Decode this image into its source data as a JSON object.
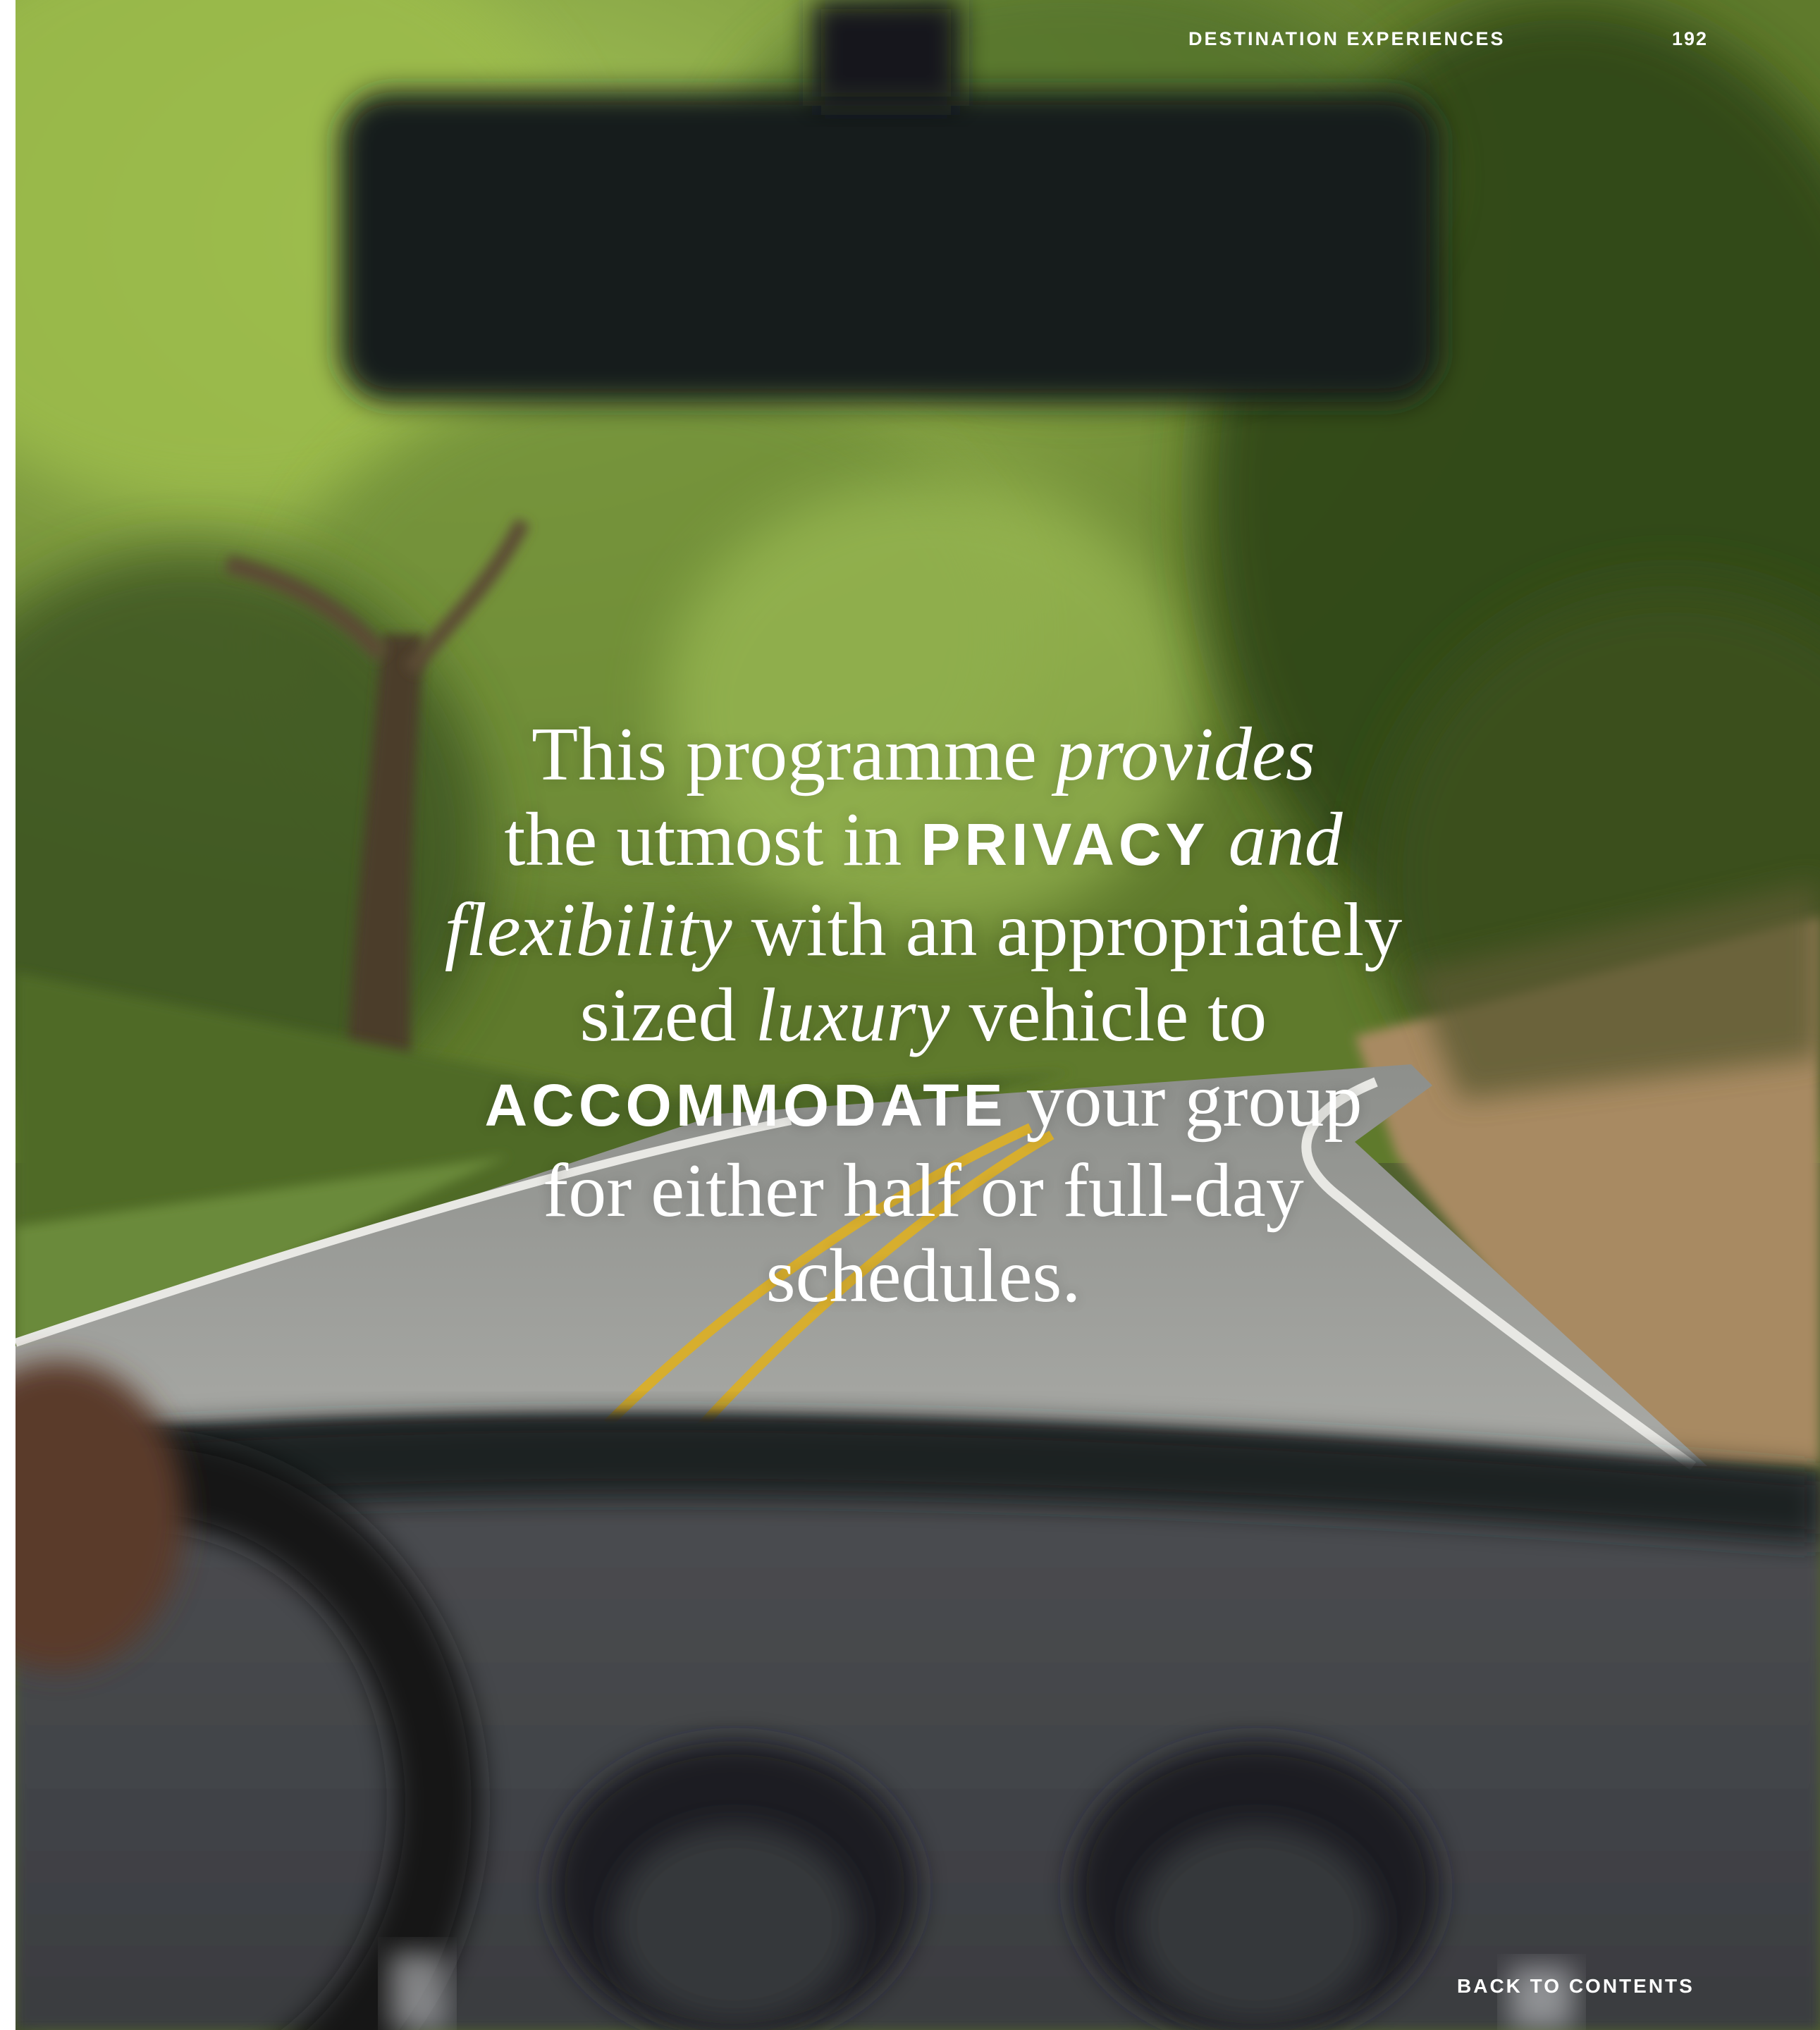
{
  "header": {
    "section": "DESTINATION EXPERIENCES",
    "page_number": "192"
  },
  "quote": {
    "l1a": "This programme ",
    "l1b": "provides",
    "l2a": "the utmost in ",
    "l2b": "PRIVACY",
    "l2c": " and",
    "l3a": "flexibility",
    "l3b": " with an appropriately",
    "l4a": "sized ",
    "l4b": "luxury",
    "l4c": " vehicle to",
    "l5a": "ACCOMMODATE",
    "l5b": " your group",
    "l6": "for either half or full-day",
    "l7": "schedules."
  },
  "footer": {
    "back_link": "BACK TO CONTENTS"
  }
}
